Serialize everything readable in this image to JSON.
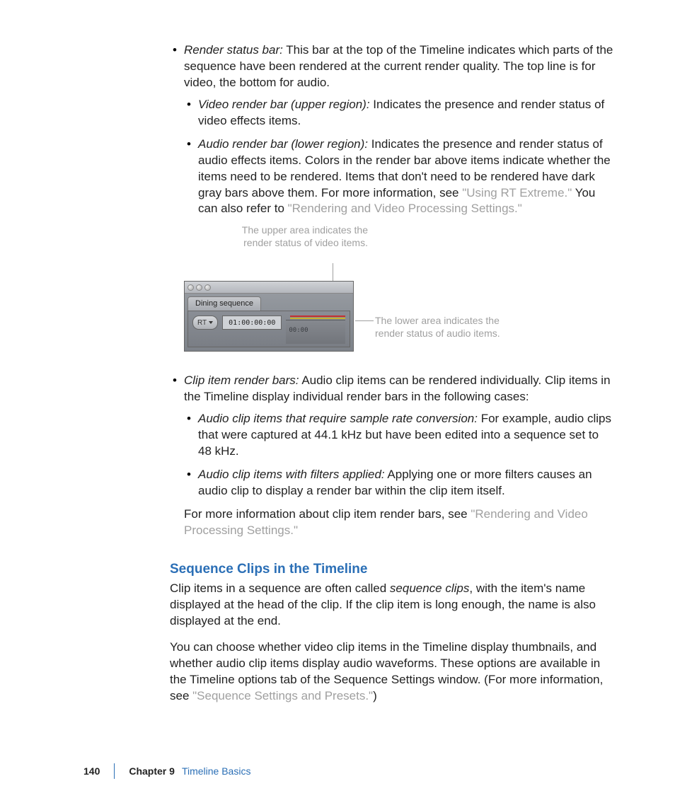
{
  "list1": {
    "item1": {
      "term": "Render status bar:",
      "text": "This bar at the top of the Timeline indicates which parts of the sequence have been rendered at the current render quality. The top line is for video, the bottom for audio.",
      "sub": [
        {
          "term": "Video render bar (upper region):",
          "text": "Indicates the presence and render status of video effects items."
        },
        {
          "term": "Audio render bar (lower region):",
          "text_before": "Indicates the presence and render status of audio effects items. Colors in the render bar above items indicate whether the items need to be rendered. Items that don't need to be rendered have dark gray bars above them. For more information, see ",
          "link1": "\"Using RT Extreme.\"",
          "text_mid": " You can also refer to ",
          "link2": "\"Rendering and Video Processing Settings.\""
        }
      ]
    },
    "item2": {
      "term": "Clip item render bars:",
      "text": "Audio clip items can be rendered individually. Clip items in the Timeline display individual render bars in the following cases:",
      "sub": [
        {
          "term": "Audio clip items that require sample rate conversion:",
          "text": "For example, audio clips that were captured at 44.1 kHz but have been edited into a sequence set to 48 kHz."
        },
        {
          "term": "Audio clip items with filters applied:",
          "text": "Applying one or more filters causes an audio clip to display a render bar within the clip item itself."
        }
      ],
      "after_text": "For more information about clip item render bars, see ",
      "after_link": "\"Rendering and Video Processing Settings.\""
    }
  },
  "figure": {
    "callout_top": "The upper area indicates the render status of video items.",
    "callout_right": "The lower area indicates the render status of audio items.",
    "tab": "Dining sequence",
    "rt": "RT",
    "timecode": "01:00:00:00",
    "ruler_label": "00:00"
  },
  "section": {
    "heading": "Sequence Clips in the Timeline",
    "p1_a": "Clip items in a sequence are often called ",
    "p1_em": "sequence clips",
    "p1_b": ", with the item's name displayed at the head of the clip. If the clip item is long enough, the name is also displayed at the end.",
    "p2_a": "You can choose whether video clip items in the Timeline display thumbnails, and whether audio clip items display audio waveforms. These options are available in the Timeline options tab of the Sequence Settings window. (For more information, see ",
    "p2_link": "\"Sequence Settings and Presets.\"",
    "p2_b": ")"
  },
  "footer": {
    "page": "140",
    "chapter": "Chapter 9",
    "title": "Timeline Basics"
  }
}
